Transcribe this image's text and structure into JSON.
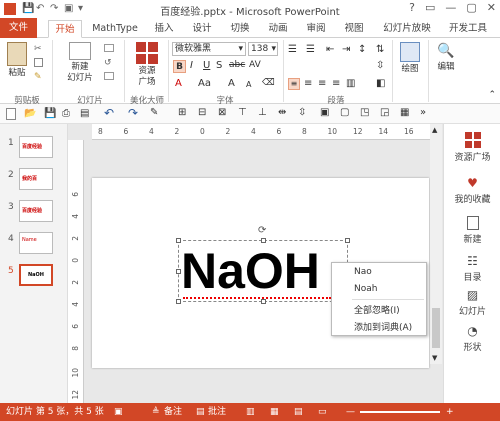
{
  "titlebar": {
    "title": "百度经验.pptx - Microsoft PowerPoint",
    "help": "?",
    "minimize": "—",
    "restore": "▢",
    "close": "✕"
  },
  "tabs": [
    "文件",
    "开始",
    "MathType",
    "插入",
    "设计",
    "切换",
    "动画",
    "审阅",
    "视图",
    "幻灯片放映",
    "开发工具"
  ],
  "ribbon": {
    "clipboard": {
      "paste": "粘贴",
      "label": "剪贴板"
    },
    "slides": {
      "new_slide": "新建\n幻灯片",
      "label": "幻灯片"
    },
    "beautify": {
      "resource": "资源\n广场",
      "label": "美化大师"
    },
    "font": {
      "name": "微软雅黑",
      "size": "138",
      "label": "字体"
    },
    "paragraph": {
      "label": "段落"
    },
    "drawing": {
      "draw": "绘图"
    },
    "editing": {
      "edit": "编辑"
    }
  },
  "thumbnails": [
    {
      "num": "1",
      "text": "百度经验"
    },
    {
      "num": "2",
      "text": "我的百"
    },
    {
      "num": "3",
      "text": "百度经验"
    },
    {
      "num": "4",
      "text": "Name"
    },
    {
      "num": "5",
      "text": "NaOH"
    }
  ],
  "ruler_h": [
    "8",
    "6",
    "4",
    "2",
    "0",
    "2",
    "4",
    "6",
    "8",
    "10",
    "12",
    "14",
    "16"
  ],
  "ruler_v": [
    "6",
    "4",
    "2",
    "0",
    "2",
    "4",
    "6",
    "8",
    "10",
    "12"
  ],
  "slide": {
    "text": "NaOH"
  },
  "context_menu": [
    "Nao",
    "Noah",
    "全部忽略(I)",
    "添加到词典(A)"
  ],
  "right_pane": [
    "资源广场",
    "我的收藏",
    "新建",
    "目录",
    "幻灯片",
    "形状"
  ],
  "statusbar": {
    "slide_info": "幻灯片 第 5 张，共 5 张",
    "notes": "备注",
    "comments": "批注"
  },
  "colors": {
    "accent": "#d24726",
    "resource_red": "#c0392b"
  }
}
